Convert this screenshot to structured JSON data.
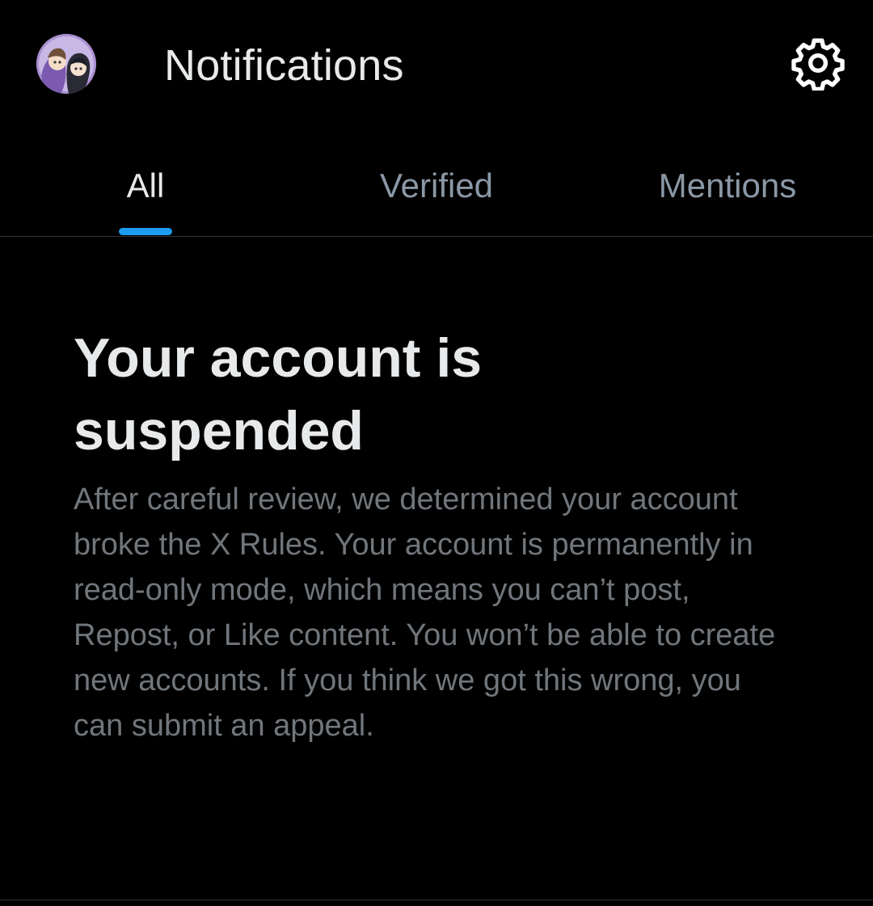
{
  "header": {
    "title": "Notifications",
    "avatar_icon": "profile-avatar",
    "settings_icon": "gear-icon"
  },
  "tabs": [
    {
      "label": "All",
      "active": true
    },
    {
      "label": "Verified",
      "active": false
    },
    {
      "label": "Mentions",
      "active": false
    }
  ],
  "notice": {
    "title": "Your account is suspended",
    "body": "After careful review, we determined your account broke the X Rules. Your account is permanently in read-only mode, which means you can’t post, Repost, or Like content. You won’t be able to create new accounts. If you think we got this wrong, you can submit an appeal."
  },
  "colors": {
    "background": "#000000",
    "primary_text": "#e7e9ea",
    "secondary_text": "#71767b",
    "accent": "#1d9bf0",
    "divider": "#2f3336"
  }
}
